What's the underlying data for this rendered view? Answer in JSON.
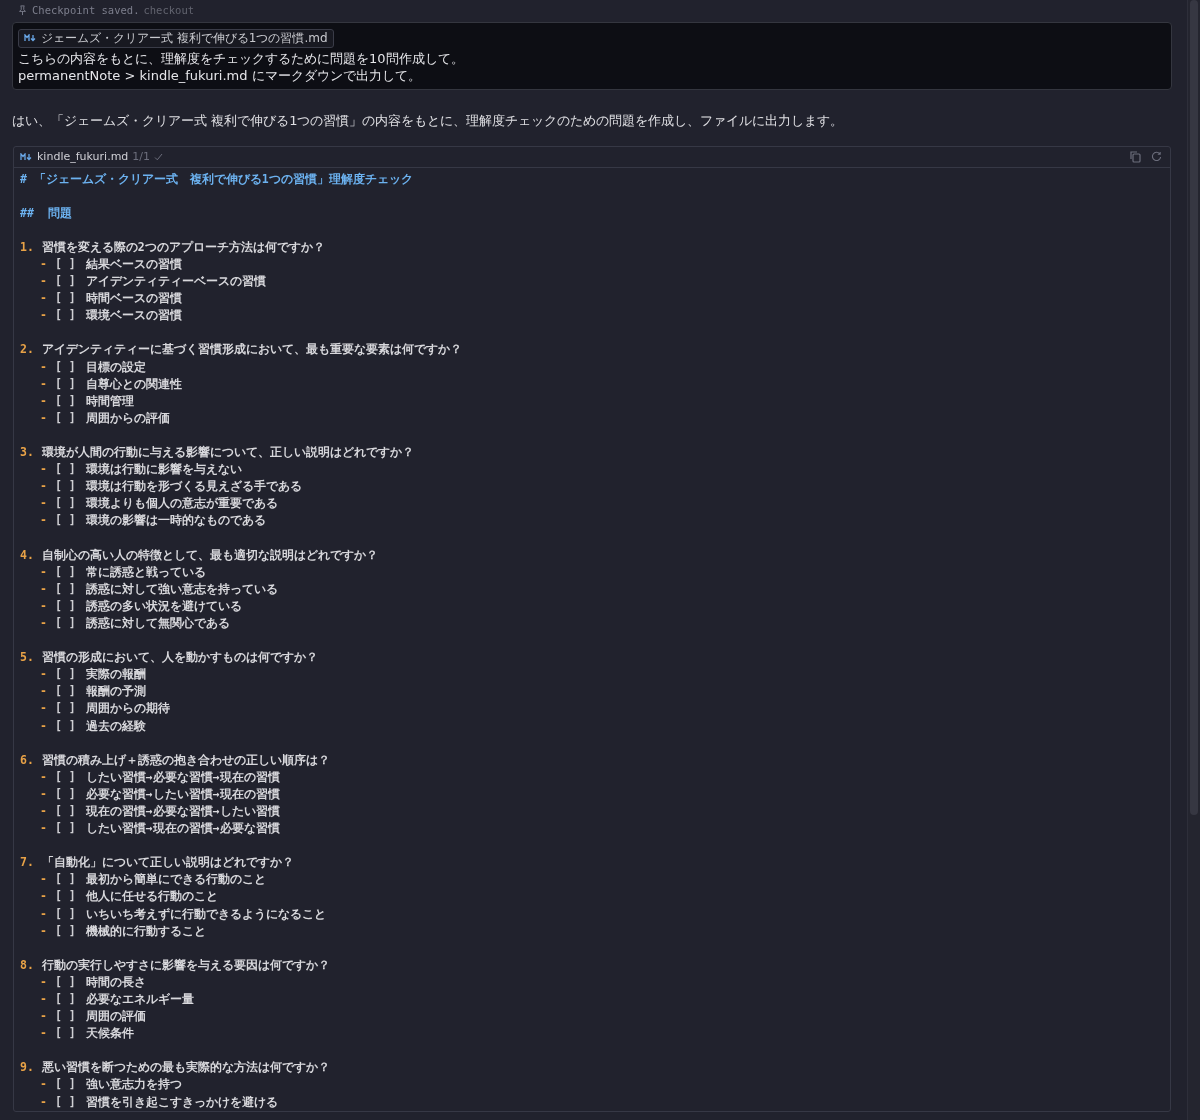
{
  "checkpoint": {
    "label": "Checkpoint saved.",
    "link": "checkout"
  },
  "user_message": {
    "attachment": "ジェームズ・クリアー式 複利で伸びる1つの習慣.md",
    "lines": [
      "こちらの内容をもとに、理解度をチェックするために問題を10問作成して。",
      "permanentNote > kindle_fukuri.md にマークダウンで出力して。"
    ]
  },
  "reply": "はい、「ジェームズ・クリアー式 複利で伸びる1つの習慣」の内容をもとに、理解度チェックのための問題を作成し、ファイルに出力します。",
  "code_block": {
    "filename": "kindle_fukuri.md",
    "count": "1/1",
    "heading": {
      "marker": "#",
      "text": "「ジェームズ・クリアー式　複利で伸びる1つの習慣」理解度チェック"
    },
    "subheading": {
      "marker": "##",
      "text": "問題"
    },
    "questions": [
      {
        "number": "1.",
        "text": "習慣を変える際の2つのアプローチ方法は何ですか？",
        "options": [
          {
            "bullet": "-",
            "box": "[ ]",
            "text": "結果ベースの習慣"
          },
          {
            "bullet": "-",
            "box": "[ ]",
            "text": "アイデンティティーベースの習慣"
          },
          {
            "bullet": "-",
            "box": "[ ]",
            "text": "時間ベースの習慣"
          },
          {
            "bullet": "-",
            "box": "[ ]",
            "text": "環境ベースの習慣"
          }
        ]
      },
      {
        "number": "2.",
        "text": "アイデンティティーに基づく習慣形成において、最も重要な要素は何ですか？",
        "options": [
          {
            "bullet": "-",
            "box": "[ ]",
            "text": "目標の設定"
          },
          {
            "bullet": "-",
            "box": "[ ]",
            "text": "自尊心との関連性"
          },
          {
            "bullet": "-",
            "box": "[ ]",
            "text": "時間管理"
          },
          {
            "bullet": "-",
            "box": "[ ]",
            "text": "周囲からの評価"
          }
        ]
      },
      {
        "number": "3.",
        "text": "環境が人間の行動に与える影響について、正しい説明はどれですか？",
        "options": [
          {
            "bullet": "-",
            "box": "[ ]",
            "text": "環境は行動に影響を与えない"
          },
          {
            "bullet": "-",
            "box": "[ ]",
            "text": "環境は行動を形づくる見えざる手である"
          },
          {
            "bullet": "-",
            "box": "[ ]",
            "text": "環境よりも個人の意志が重要である"
          },
          {
            "bullet": "-",
            "box": "[ ]",
            "text": "環境の影響は一時的なものである"
          }
        ]
      },
      {
        "number": "4.",
        "text": "自制心の高い人の特徴として、最も適切な説明はどれですか？",
        "options": [
          {
            "bullet": "-",
            "box": "[ ]",
            "text": "常に誘惑と戦っている"
          },
          {
            "bullet": "-",
            "box": "[ ]",
            "text": "誘惑に対して強い意志を持っている"
          },
          {
            "bullet": "-",
            "box": "[ ]",
            "text": "誘惑の多い状況を避けている"
          },
          {
            "bullet": "-",
            "box": "[ ]",
            "text": "誘惑に対して無関心である"
          }
        ]
      },
      {
        "number": "5.",
        "text": "習慣の形成において、人を動かすものは何ですか？",
        "options": [
          {
            "bullet": "-",
            "box": "[ ]",
            "text": "実際の報酬"
          },
          {
            "bullet": "-",
            "box": "[ ]",
            "text": "報酬の予測"
          },
          {
            "bullet": "-",
            "box": "[ ]",
            "text": "周囲からの期待"
          },
          {
            "bullet": "-",
            "box": "[ ]",
            "text": "過去の経験"
          }
        ]
      },
      {
        "number": "6.",
        "text": "習慣の積み上げ＋誘惑の抱き合わせの正しい順序は？",
        "options": [
          {
            "bullet": "-",
            "box": "[ ]",
            "text": "したい習慣→必要な習慣→現在の習慣"
          },
          {
            "bullet": "-",
            "box": "[ ]",
            "text": "必要な習慣→したい習慣→現在の習慣"
          },
          {
            "bullet": "-",
            "box": "[ ]",
            "text": "現在の習慣→必要な習慣→したい習慣"
          },
          {
            "bullet": "-",
            "box": "[ ]",
            "text": "したい習慣→現在の習慣→必要な習慣"
          }
        ]
      },
      {
        "number": "7.",
        "text": "「自動化」について正しい説明はどれですか？",
        "options": [
          {
            "bullet": "-",
            "box": "[ ]",
            "text": "最初から簡単にできる行動のこと"
          },
          {
            "bullet": "-",
            "box": "[ ]",
            "text": "他人に任せる行動のこと"
          },
          {
            "bullet": "-",
            "box": "[ ]",
            "text": "いちいち考えずに行動できるようになること"
          },
          {
            "bullet": "-",
            "box": "[ ]",
            "text": "機械的に行動すること"
          }
        ]
      },
      {
        "number": "8.",
        "text": "行動の実行しやすさに影響を与える要因は何ですか？",
        "options": [
          {
            "bullet": "-",
            "box": "[ ]",
            "text": "時間の長さ"
          },
          {
            "bullet": "-",
            "box": "[ ]",
            "text": "必要なエネルギー量"
          },
          {
            "bullet": "-",
            "box": "[ ]",
            "text": "周囲の評価"
          },
          {
            "bullet": "-",
            "box": "[ ]",
            "text": "天候条件"
          }
        ]
      },
      {
        "number": "9.",
        "text": "悪い習慣を断つための最も実際的な方法は何ですか？",
        "options": [
          {
            "bullet": "-",
            "box": "[ ]",
            "text": "強い意志力を持つ"
          },
          {
            "bullet": "-",
            "box": "[ ]",
            "text": "習慣を引き起こすきっかけを避ける"
          }
        ]
      }
    ]
  }
}
